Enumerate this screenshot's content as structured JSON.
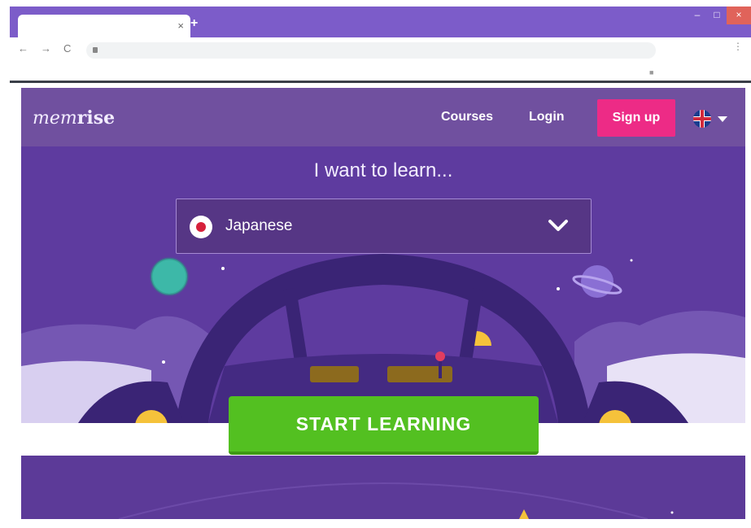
{
  "browser": {
    "new_tab_symbol": "+",
    "tab_close_symbol": "×",
    "back_symbol": "←",
    "forward_symbol": "→",
    "reload_symbol": "C",
    "menu_symbol": "⋮",
    "minimize_symbol": "–",
    "maximize_symbol": "□",
    "close_symbol": "×",
    "accent_color": "#7c5cc9"
  },
  "site": {
    "logo_light": "mem",
    "logo_bold": "rise",
    "nav": {
      "courses": "Courses",
      "login": "Login",
      "signup": "Sign up"
    },
    "language_icon": "uk-flag-icon",
    "brand_pink": "#ed2b86"
  },
  "hero": {
    "headline": "I want to learn...",
    "selected_language": "Japanese",
    "selected_language_icon": "japan-flag-icon",
    "cta": "START LEARNING",
    "cta_color": "#53c021",
    "background_color": "#5e3b9f"
  }
}
